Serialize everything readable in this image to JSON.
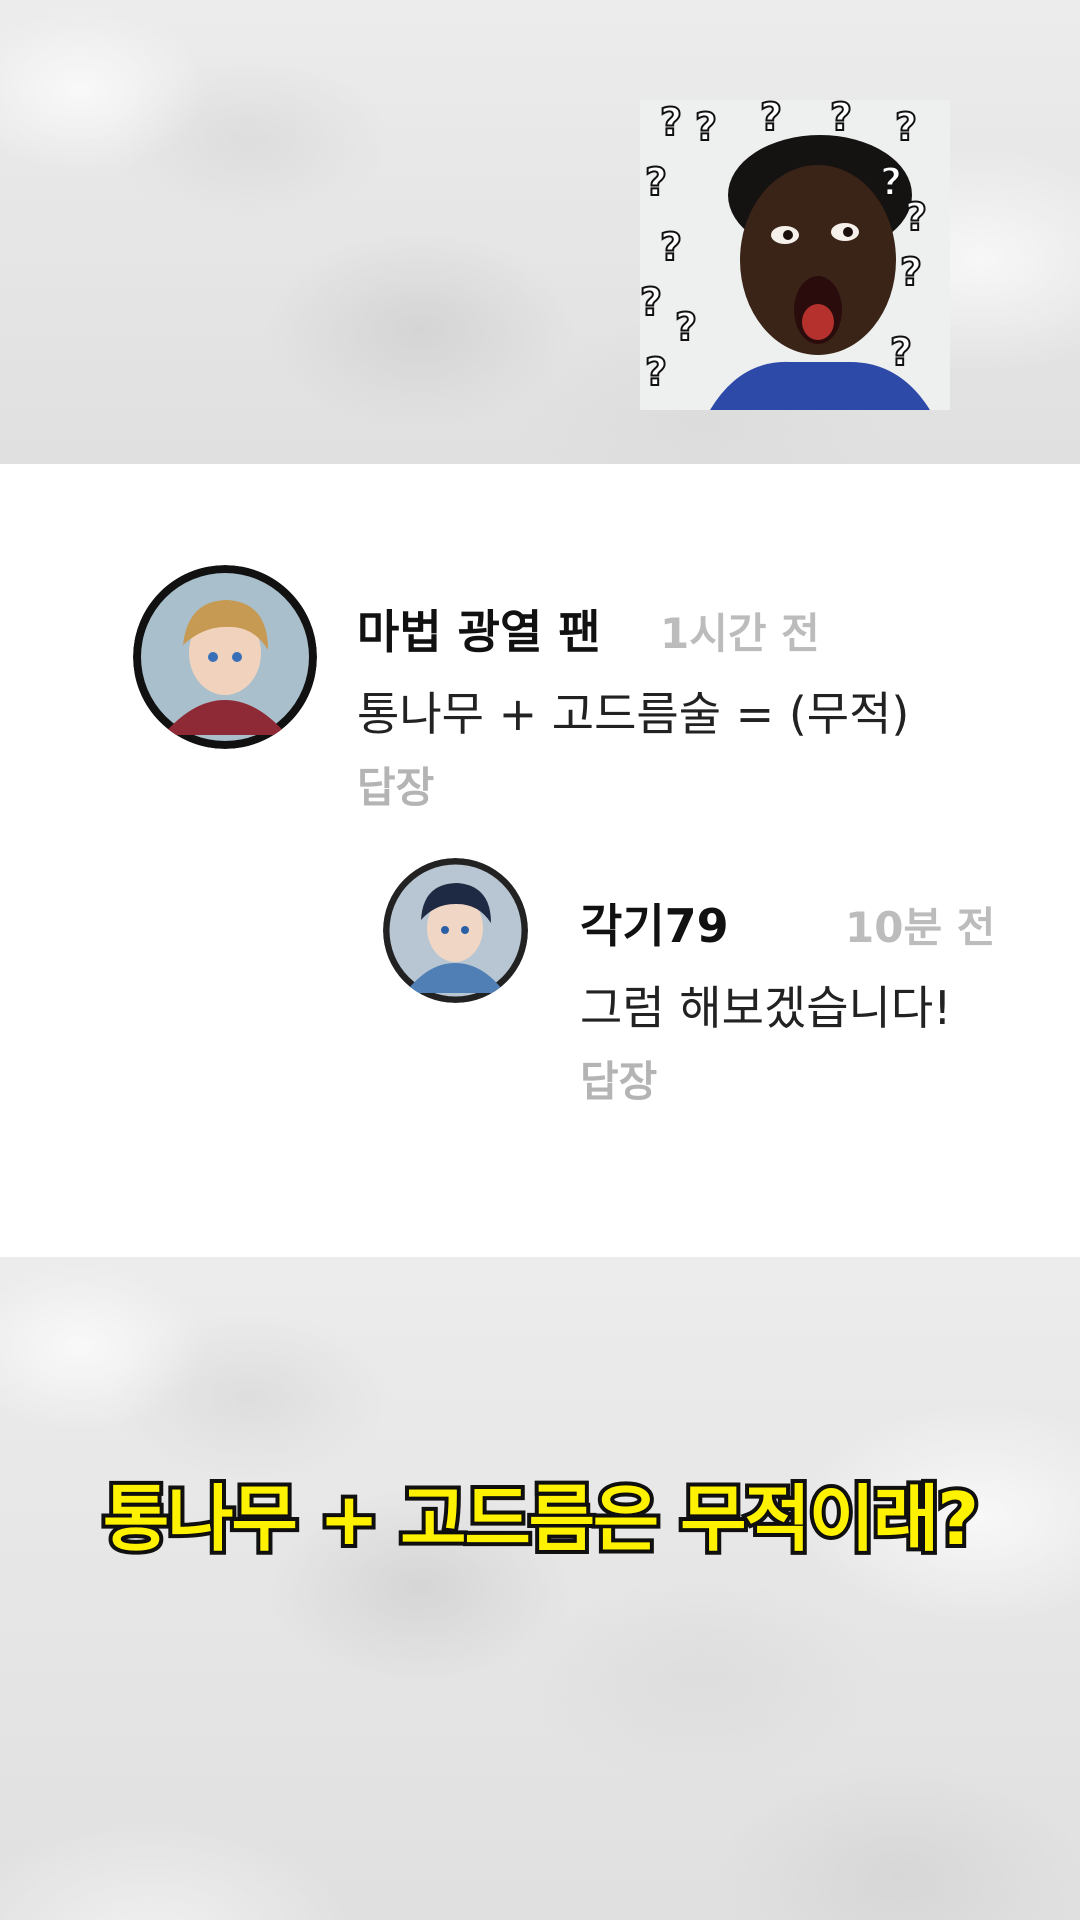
{
  "comments": [
    {
      "author": "마법 광열 팬",
      "time": "1시간 전",
      "text": "통나무 + 고드름술 = (무적)",
      "reply_label": "답장"
    },
    {
      "author": "각기79",
      "time": "10분 전",
      "text": "그럼 해보겠습니다!",
      "reply_label": "답장"
    }
  ],
  "caption": "통나무 + 고드름은 무적이래?",
  "colors": {
    "caption_fill": "#fff200",
    "caption_stroke": "#111111",
    "timestamp": "#bcbcbc",
    "reply": "#b4b4b4"
  }
}
